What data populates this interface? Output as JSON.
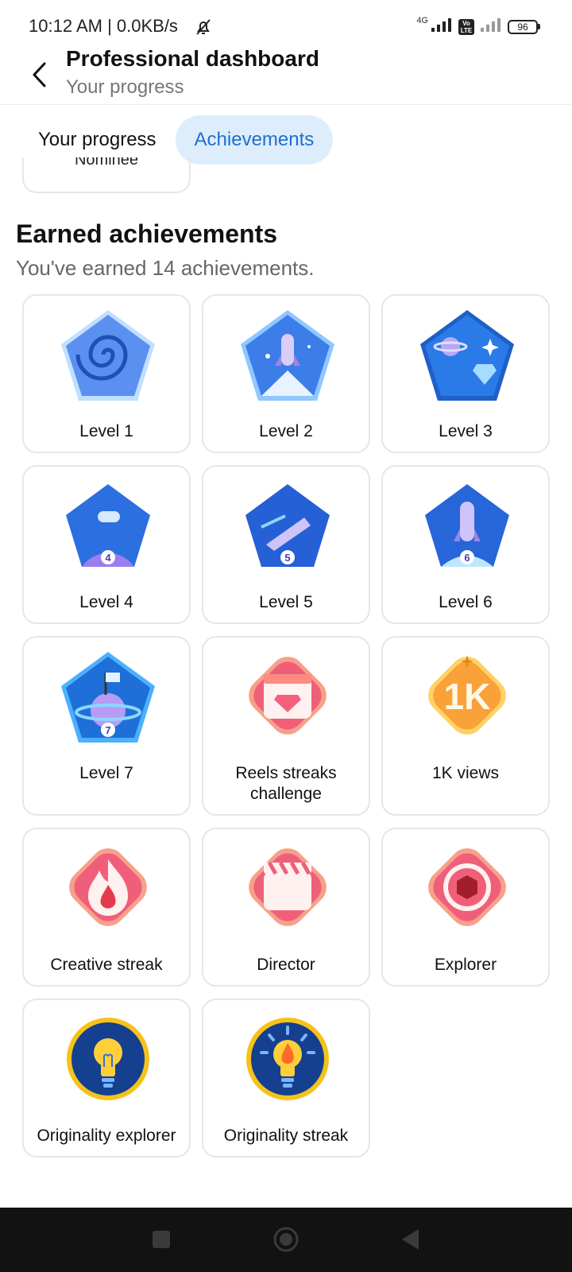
{
  "status_bar": {
    "time_text": "10:12 AM | 0.0KB/s",
    "network_label": "4G",
    "volte_label": "Vo\nLTE",
    "battery": "96"
  },
  "header": {
    "title": "Professional dashboard",
    "subtitle": "Your progress"
  },
  "tabs": [
    {
      "label": "Your progress",
      "active": false
    },
    {
      "label": "Achievements",
      "active": true
    }
  ],
  "partial_card_label": "Nominee",
  "earned": {
    "title": "Earned achievements",
    "subtitle": "You've earned 14 achievements."
  },
  "achievements": [
    {
      "label": "Level 1",
      "icon": "galaxy-icon"
    },
    {
      "label": "Level 2",
      "icon": "rocket-launch-icon"
    },
    {
      "label": "Level 3",
      "icon": "planet-diamond-icon"
    },
    {
      "label": "Level 4",
      "icon": "spaceship-planet-icon",
      "number": "4"
    },
    {
      "label": "Level 5",
      "icon": "spaceship-comet-icon",
      "number": "5"
    },
    {
      "label": "Level 6",
      "icon": "rocket-moon-icon",
      "number": "6"
    },
    {
      "label": "Level 7",
      "icon": "planet-flag-icon",
      "number": "7"
    },
    {
      "label": "Reels streaks challenge",
      "icon": "clapper-diamond-icon"
    },
    {
      "label": "1K views",
      "icon": "views-1k-icon",
      "badge_text": "1K"
    },
    {
      "label": "Creative streak",
      "icon": "flame-icon"
    },
    {
      "label": "Director",
      "icon": "clapperboard-icon"
    },
    {
      "label": "Explorer",
      "icon": "aperture-icon"
    },
    {
      "label": "Originality explorer",
      "icon": "lightbulb-icon"
    },
    {
      "label": "Originality streak",
      "icon": "lightbulb-flame-icon"
    }
  ]
}
